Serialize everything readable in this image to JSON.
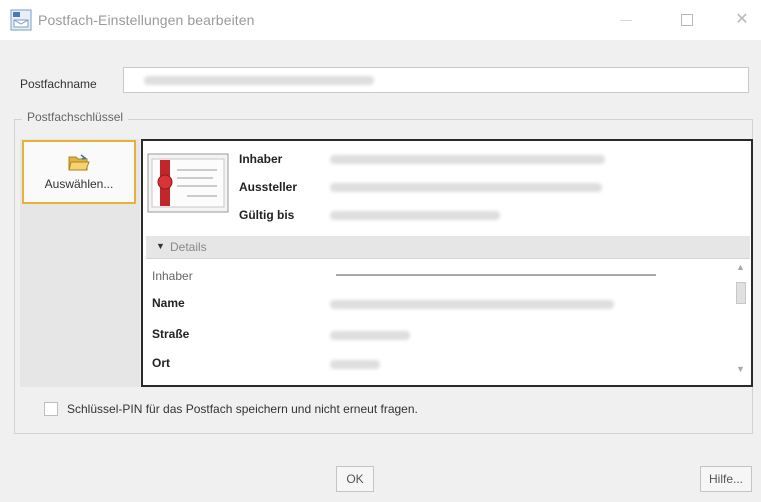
{
  "window": {
    "title": "Postfach-Einstellungen bearbeiten",
    "controls": {
      "minimize": "—",
      "maximize": "☐",
      "close": "✕"
    }
  },
  "mailbox": {
    "name_label": "Postfachname",
    "name_value": ""
  },
  "key_group": {
    "title": "Postfachschlüssel",
    "select_button": "Auswählen...",
    "certificate": {
      "holder_label": "Inhaber",
      "issuer_label": "Aussteller",
      "valid_until_label": "Gültig bis"
    },
    "details": {
      "label": "Details",
      "rows": [
        {
          "label": "Inhaber"
        },
        {
          "label": "Name"
        },
        {
          "label": "Straße"
        },
        {
          "label": "Ort"
        }
      ]
    }
  },
  "save_pin_checkbox": {
    "label": "Schlüssel-PIN für das Postfach speichern und nicht erneut fragen.",
    "checked": false
  },
  "buttons": {
    "ok": "OK",
    "help": "Hilfe..."
  },
  "colors": {
    "select_border": "#e8b13c",
    "cert_border": "#2a2a2a",
    "dialog_bg": "#f0f0f0"
  },
  "icons": [
    "app-icon",
    "folder-open-icon",
    "certificate-icon",
    "disclosure-triangle-icon",
    "scroll-up-icon",
    "scroll-down-icon"
  ]
}
